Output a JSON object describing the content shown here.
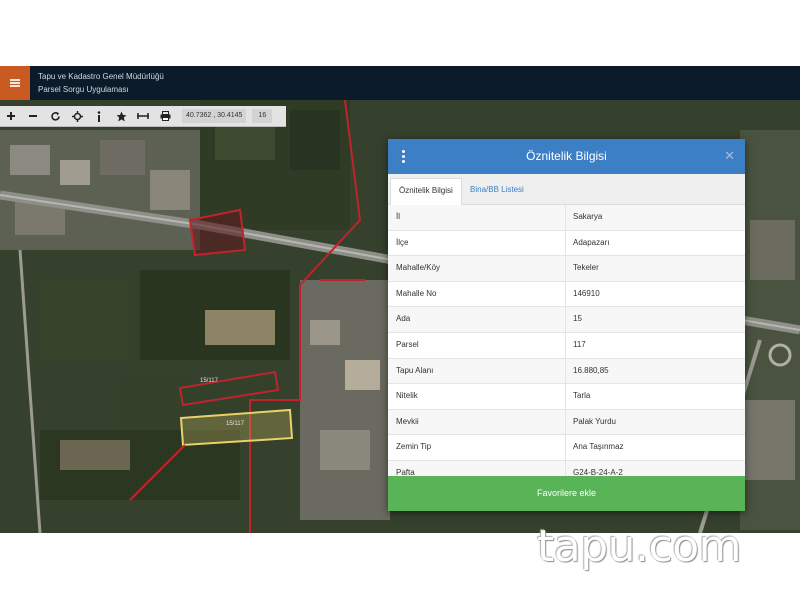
{
  "header": {
    "line1": "Tapu ve Kadastro Genel Müdürlüğü",
    "line2": "Parsel Sorgu Uygulaması",
    "menu_icon": "hamburger-icon"
  },
  "toolbar": {
    "tools": [
      {
        "name": "zoom-in",
        "icon": "plus-icon"
      },
      {
        "name": "zoom-out",
        "icon": "minus-icon"
      },
      {
        "name": "refresh",
        "icon": "refresh-icon"
      },
      {
        "name": "locate",
        "icon": "locate-icon"
      },
      {
        "name": "info",
        "icon": "info-icon"
      },
      {
        "name": "favorites",
        "icon": "star-icon"
      },
      {
        "name": "measure",
        "icon": "ruler-icon"
      },
      {
        "name": "print",
        "icon": "print-icon"
      }
    ],
    "coordinates": "40.7362 , 30.4145",
    "zoom": "16"
  },
  "map": {
    "parcel_labels": [
      "15/117",
      "15/117"
    ]
  },
  "dialog": {
    "title": "Öznitelik Bilgisi",
    "close": "✕",
    "tabs": [
      {
        "label": "Öznitelik Bilgisi",
        "active": true
      },
      {
        "label": "Bina/BB Listesi",
        "active": false
      }
    ],
    "rows": [
      {
        "key": "İl",
        "value": "Sakarya"
      },
      {
        "key": "İlçe",
        "value": "Adapazarı"
      },
      {
        "key": "Mahalle/Köy",
        "value": "Tekeler"
      },
      {
        "key": "Mahalle No",
        "value": "146910"
      },
      {
        "key": "Ada",
        "value": "15"
      },
      {
        "key": "Parsel",
        "value": "117"
      },
      {
        "key": "Tapu Alanı",
        "value": "16.880,85"
      },
      {
        "key": "Nitelik",
        "value": "Tarla"
      },
      {
        "key": "Mevkii",
        "value": "Palak Yurdu"
      },
      {
        "key": "Zemin Tip",
        "value": "Ana Taşınmaz"
      },
      {
        "key": "Pafta",
        "value": "G24-B-24-A-2"
      }
    ],
    "favorite_button": "Favorilere ekle"
  },
  "watermark": "tapu.com",
  "colors": {
    "header_bg": "#0c1b2a",
    "menu_accent": "#c95a22",
    "dialog_header": "#3c7fc5",
    "favorite_button": "#59b357",
    "parcel_highlight": "#e8d36a",
    "parcel_border": "#c0232b"
  }
}
